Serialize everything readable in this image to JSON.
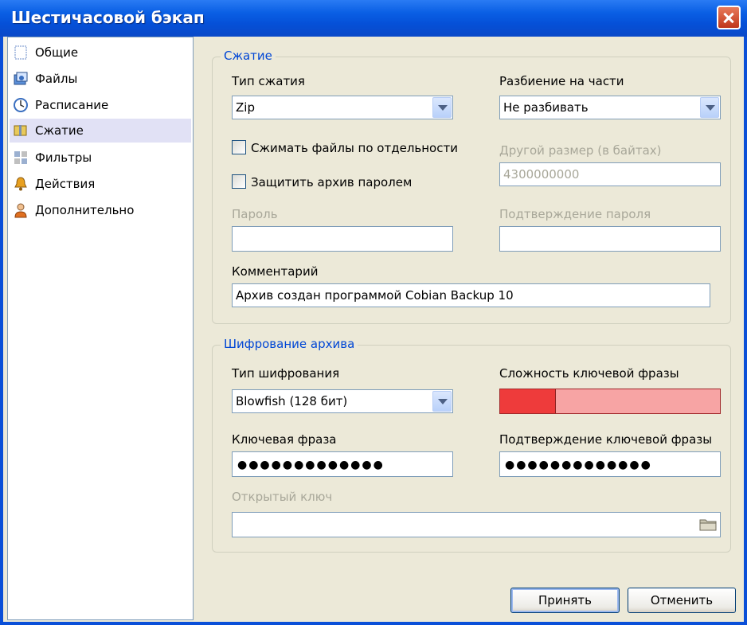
{
  "window": {
    "title": "Шестичасовой бэкап"
  },
  "sidebar": {
    "items": [
      {
        "label": "Общие",
        "icon": "general-icon"
      },
      {
        "label": "Файлы",
        "icon": "files-icon"
      },
      {
        "label": "Расписание",
        "icon": "clock-icon"
      },
      {
        "label": "Сжатие",
        "icon": "compression-icon",
        "selected": true
      },
      {
        "label": "Фильтры",
        "icon": "filter-icon"
      },
      {
        "label": "Действия",
        "icon": "bell-icon"
      },
      {
        "label": "Дополнительно",
        "icon": "user-icon"
      }
    ]
  },
  "compression": {
    "group_title": "Сжатие",
    "type_label": "Тип сжатия",
    "type_value": "Zip",
    "split_label": "Разбиение на части",
    "split_value": "Не разбивать",
    "separate_files_label": "Сжимать файлы по отдельности",
    "separate_files_checked": false,
    "protect_label": "Защитить архив паролем",
    "protect_checked": false,
    "other_size_label": "Другой размер (в байтах)",
    "other_size_value": "4300000000",
    "password_label": "Пароль",
    "password_value": "",
    "password_confirm_label": "Подтверждение пароля",
    "password_confirm_value": "",
    "comment_label": "Комментарий",
    "comment_value": "Архив создан программой Cobian Backup 10"
  },
  "encryption": {
    "group_title": "Шифрование архива",
    "type_label": "Тип шифрования",
    "type_value": "Blowfish (128 бит)",
    "strength_label": "Сложность ключевой фразы",
    "strength_fraction": 0.25,
    "strength_colors": {
      "fill": "#ee3b3b",
      "track": "#f7a4a4"
    },
    "passphrase_label": "Ключевая фраза",
    "passphrase_value": "●●●●●●●●●●●●●",
    "passphrase_confirm_label": "Подтверждение ключевой фразы",
    "passphrase_confirm_value": "●●●●●●●●●●●●●",
    "public_key_label": "Открытый ключ",
    "public_key_value": ""
  },
  "buttons": {
    "ok": "Принять",
    "cancel": "Отменить"
  }
}
